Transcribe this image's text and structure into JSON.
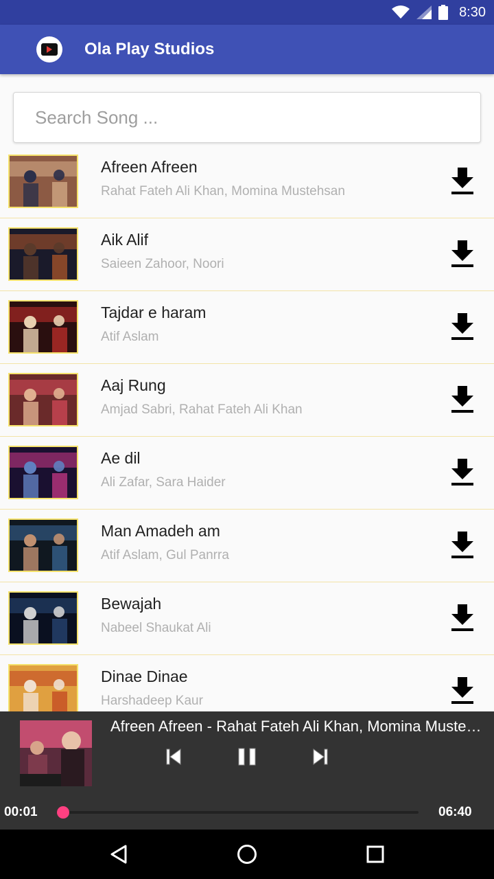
{
  "status_bar": {
    "time": "8:30"
  },
  "app_bar": {
    "title": "Ola Play Studios"
  },
  "search": {
    "placeholder": "Search Song ...",
    "value": ""
  },
  "songs": [
    {
      "title": "Afreen Afreen",
      "artist": "Rahat Fateh Ali Khan, Momina Mustehsan"
    },
    {
      "title": "Aik Alif",
      "artist": "Saieen Zahoor, Noori"
    },
    {
      "title": "Tajdar e haram",
      "artist": "Atif Aslam"
    },
    {
      "title": "Aaj Rung",
      "artist": "Amjad Sabri,  Rahat Fateh Ali Khan"
    },
    {
      "title": "Ae dil",
      "artist": "Ali Zafar, Sara Haider"
    },
    {
      "title": "Man Amadeh am",
      "artist": "Atif Aslam, Gul Panrra"
    },
    {
      "title": "Bewajah",
      "artist": "Nabeel Shaukat Ali"
    },
    {
      "title": "Dinae Dinae",
      "artist": "Harshadeep Kaur"
    }
  ],
  "player": {
    "now_playing": "Afreen Afreen - Rahat Fateh Ali Khan, Momina Mustehsan",
    "elapsed": "00:01",
    "duration": "06:40",
    "progress_fraction": 0.0025
  },
  "colors": {
    "status_bar": "#303f9f",
    "app_bar": "#3f51b5",
    "accent": "#ff4081",
    "thumb_border": "#f5e26b",
    "player_bg": "#333333"
  }
}
